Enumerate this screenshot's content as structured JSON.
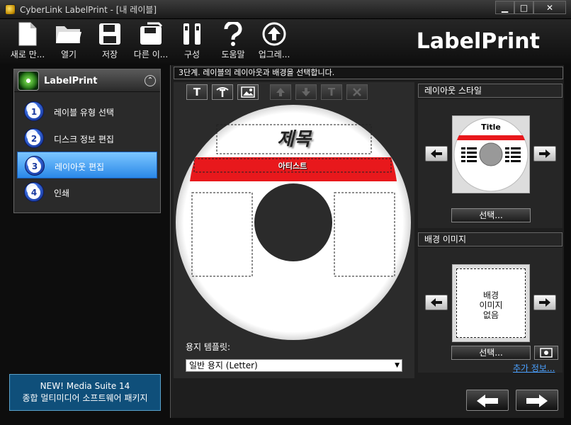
{
  "window": {
    "title": "CyberLink LabelPrint - [내 레이블]",
    "minimize": "▁",
    "maximize": "□",
    "close": "✕"
  },
  "toolbar": {
    "items": [
      {
        "label": "새로 만...",
        "icon": "new-document-icon"
      },
      {
        "label": "열기",
        "icon": "open-folder-icon"
      },
      {
        "label": "저장",
        "icon": "save-disk-icon"
      },
      {
        "label": "다른 이...",
        "icon": "save-as-icon"
      },
      {
        "label": "구성",
        "icon": "tools-icon"
      },
      {
        "label": "도움말",
        "icon": "help-icon"
      },
      {
        "label": "업그레...",
        "icon": "upgrade-icon"
      }
    ],
    "brand": "LabelPrint"
  },
  "sidebar": {
    "title": "LabelPrint",
    "collapse": "⌃",
    "steps": [
      {
        "num": "1",
        "label": "레이블 유형 선택",
        "active": false
      },
      {
        "num": "2",
        "label": "디스크 정보 편집",
        "active": false
      },
      {
        "num": "3",
        "label": "레이아웃 편집",
        "active": true
      },
      {
        "num": "4",
        "label": "인쇄",
        "active": false
      }
    ]
  },
  "promo": {
    "line1": "NEW! Media Suite 14",
    "line2": "종합 멀티미디어 소프트웨어 패키지"
  },
  "main": {
    "step_text": "3단계. 레이블의 레이아웃과 배경을 선택합니다.",
    "tools": [
      "T",
      "T",
      "image",
      "up",
      "down",
      "T",
      "x"
    ],
    "disc": {
      "title": "제목",
      "artist": "아티스트"
    },
    "template_label": "용지 템플릿:",
    "template_value": "일반 용지 (Letter)",
    "template_arrow": "▼"
  },
  "layout_style": {
    "header": "레이아웃 스타일",
    "thumb_title": "Title",
    "select": "선택..."
  },
  "background": {
    "header": "배경 이미지",
    "thumb_line1": "배경",
    "thumb_line2": "이미지",
    "thumb_line3": "없음",
    "select": "선택...",
    "more_info": "추가 정보..."
  },
  "colors": {
    "accent_red": "#e8181c",
    "active_step": "#3a9cf0",
    "link": "#4aa0ff"
  }
}
